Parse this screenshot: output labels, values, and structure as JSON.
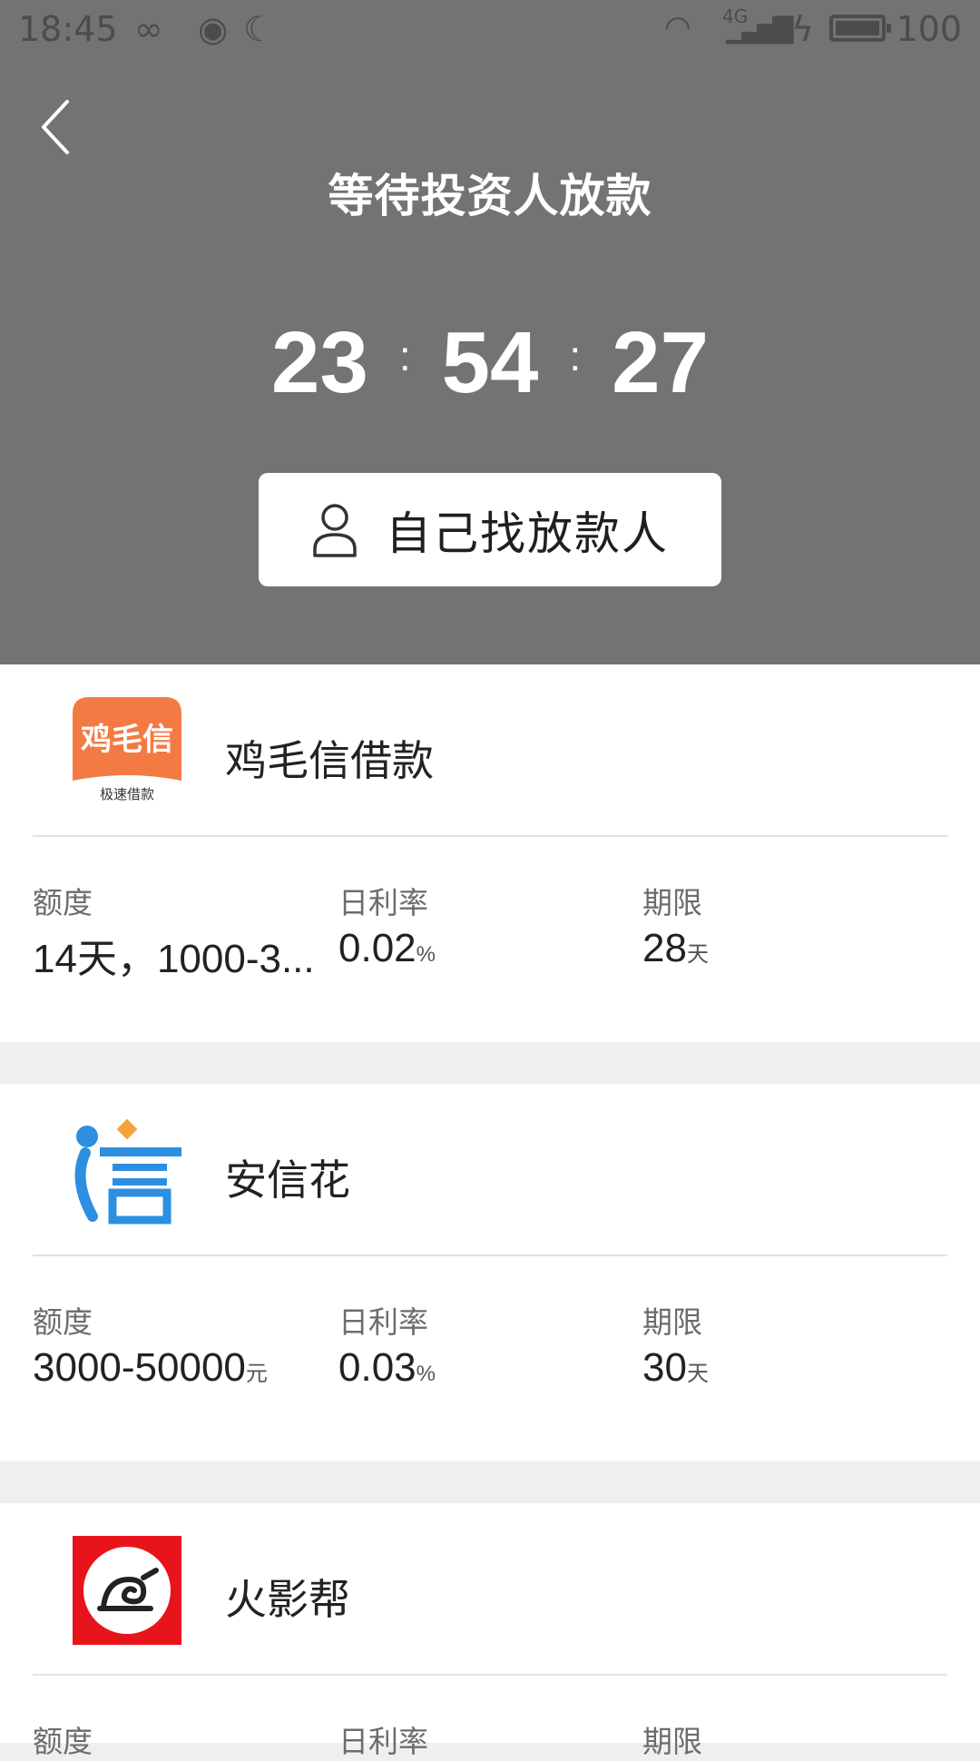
{
  "status_bar": {
    "time": "18:45",
    "battery": "100",
    "network": "4G"
  },
  "header": {
    "title": "等待投资人放款",
    "countdown": {
      "hours": "23",
      "minutes": "54",
      "seconds": "27",
      "separator": ":"
    },
    "find_lender_label": "自己找放款人"
  },
  "colors": {
    "header_bg": "#737373",
    "page_bg": "#efefef",
    "card_bg": "#ffffff"
  },
  "lenders": [
    {
      "name": "鸡毛信借款",
      "logo_text": "鸡毛信",
      "logo_subtext": "极速借款",
      "amount_label": "额度",
      "amount": "14天，1000-3...",
      "amount_unit": "",
      "rate_label": "日利率",
      "rate": "0.02",
      "rate_unit": "%",
      "term_label": "期限",
      "term": "28",
      "term_unit": "天"
    },
    {
      "name": "安信花",
      "logo_text": "信",
      "logo_subtext": "",
      "amount_label": "额度",
      "amount": "3000-50000",
      "amount_unit": "元",
      "rate_label": "日利率",
      "rate": "0.03",
      "rate_unit": "%",
      "term_label": "期限",
      "term": "30",
      "term_unit": "天"
    },
    {
      "name": "火影帮",
      "logo_text": "",
      "logo_subtext": "",
      "amount_label": "额度",
      "amount": "",
      "amount_unit": "",
      "rate_label": "日利率",
      "rate": "",
      "rate_unit": "",
      "term_label": "期限",
      "term": "",
      "term_unit": ""
    }
  ]
}
